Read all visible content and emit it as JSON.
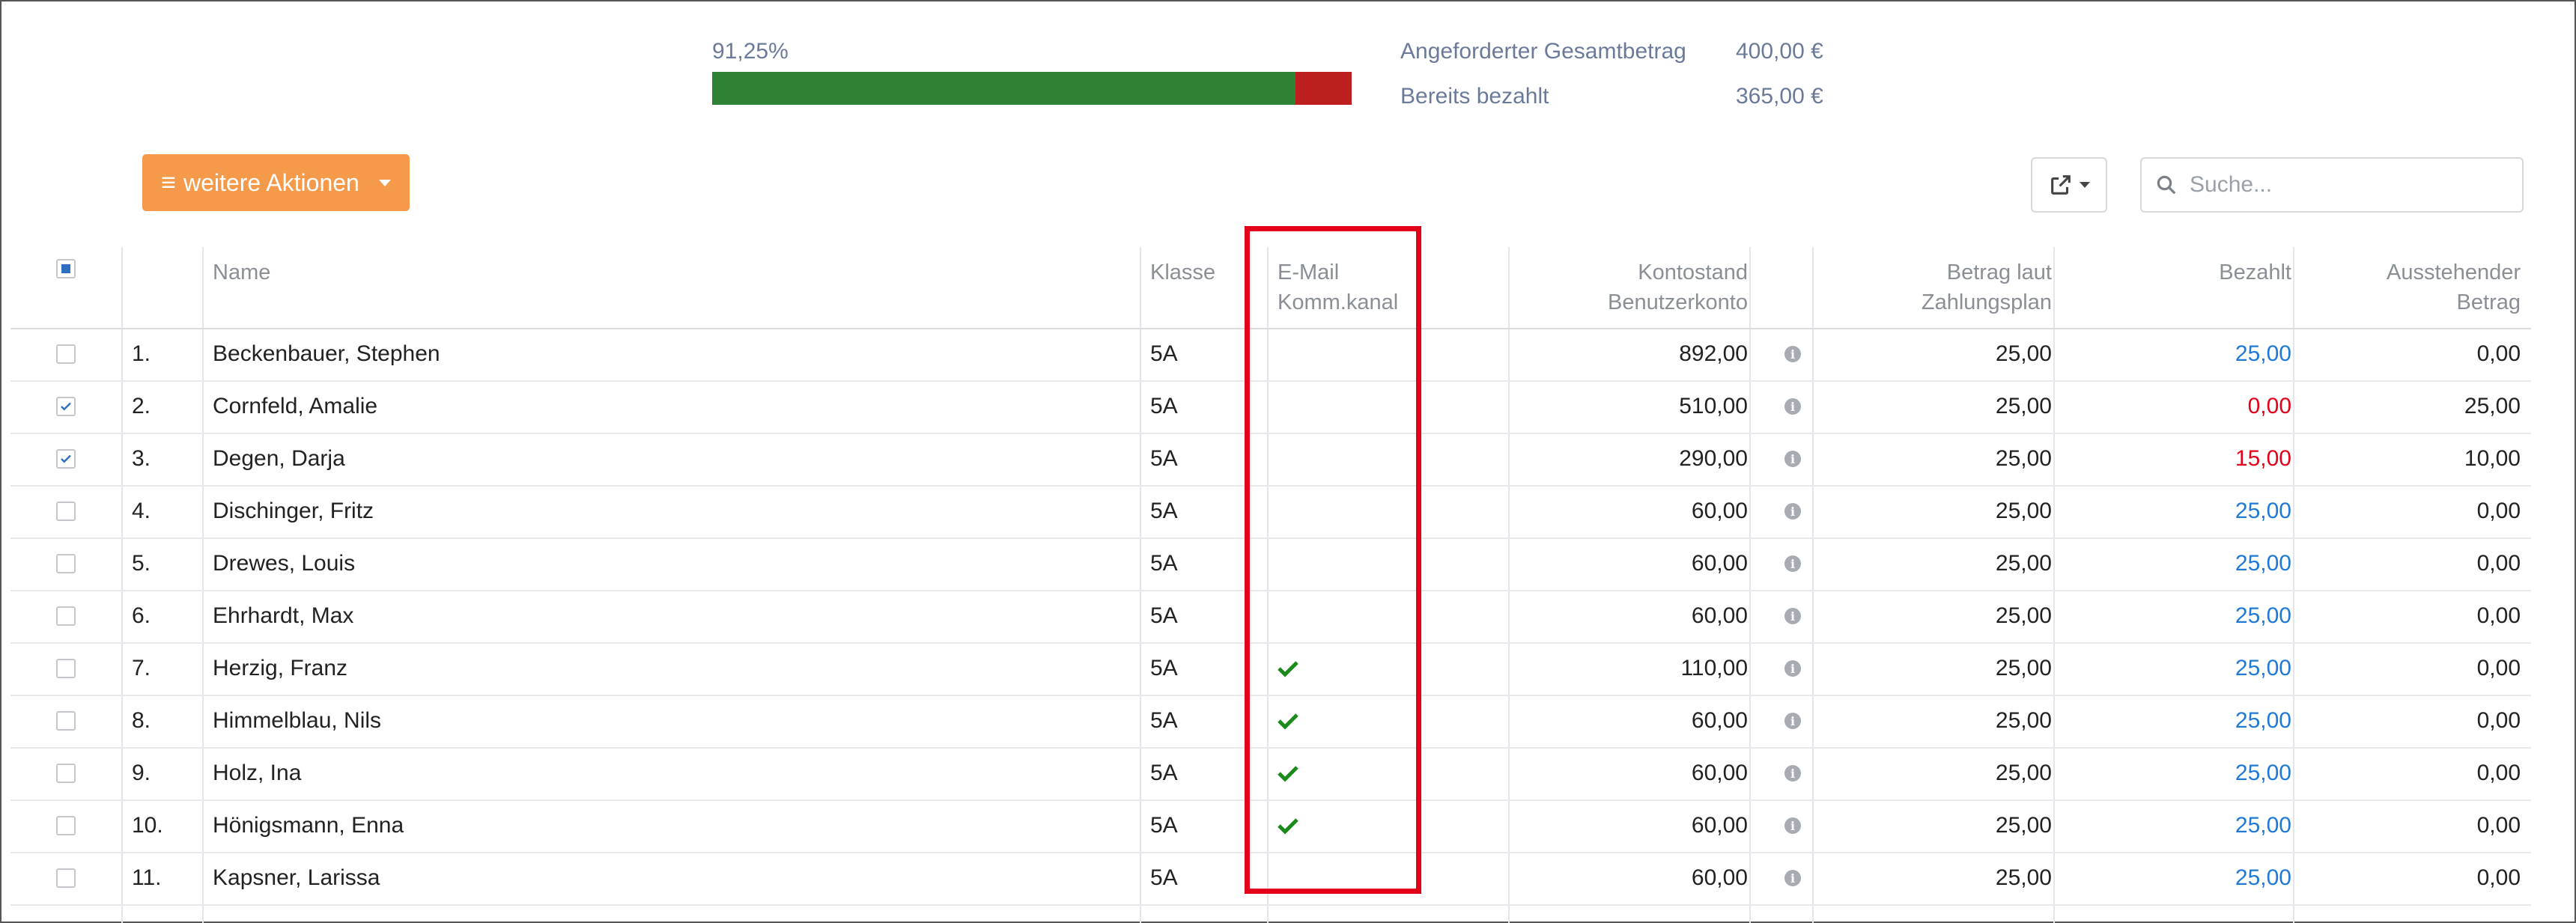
{
  "progress": {
    "label": "91,25%",
    "fraction": 0.9125
  },
  "summary": {
    "total_label": "Angeforderter Gesamtbetrag",
    "total_value": "400,00 €",
    "paid_label": "Bereits bezahlt",
    "paid_value": "365,00 €"
  },
  "toolbar": {
    "actions_label": "weitere Aktionen",
    "menu_icon": "≡",
    "search_placeholder": "Suche..."
  },
  "colors": {
    "progress_paid": "#2f8233",
    "progress_open": "#bd1e1e",
    "action_button": "#f59a4b",
    "paid_full": "#1e7ad6",
    "paid_short": "#e3001b",
    "check_green": "#1a8a1a",
    "highlight": "#e3001b"
  },
  "table": {
    "headers": {
      "name": "Name",
      "class": "Klasse",
      "email_line1": "E-Mail",
      "email_line2": "Komm.kanal",
      "konto_line1": "Kontostand",
      "konto_line2": "Benutzerkonto",
      "plan_line1": "Betrag laut",
      "plan_line2": "Zahlungsplan",
      "paid": "Bezahlt",
      "open_line1": "Ausstehender",
      "open_line2": "Betrag"
    },
    "rows": [
      {
        "checked": false,
        "num": "1.",
        "name": "Beckenbauer, Stephen",
        "class": "5A",
        "email": false,
        "konto": "892,00",
        "plan": "25,00",
        "paid": "25,00",
        "paid_status": "full",
        "open": "0,00"
      },
      {
        "checked": true,
        "num": "2.",
        "name": "Cornfeld, Amalie",
        "class": "5A",
        "email": false,
        "konto": "510,00",
        "plan": "25,00",
        "paid": "0,00",
        "paid_status": "short",
        "open": "25,00"
      },
      {
        "checked": true,
        "num": "3.",
        "name": "Degen, Darja",
        "class": "5A",
        "email": false,
        "konto": "290,00",
        "plan": "25,00",
        "paid": "15,00",
        "paid_status": "short",
        "open": "10,00"
      },
      {
        "checked": false,
        "num": "4.",
        "name": "Dischinger, Fritz",
        "class": "5A",
        "email": false,
        "konto": "60,00",
        "plan": "25,00",
        "paid": "25,00",
        "paid_status": "full",
        "open": "0,00"
      },
      {
        "checked": false,
        "num": "5.",
        "name": "Drewes, Louis",
        "class": "5A",
        "email": false,
        "konto": "60,00",
        "plan": "25,00",
        "paid": "25,00",
        "paid_status": "full",
        "open": "0,00"
      },
      {
        "checked": false,
        "num": "6.",
        "name": "Ehrhardt, Max",
        "class": "5A",
        "email": false,
        "konto": "60,00",
        "plan": "25,00",
        "paid": "25,00",
        "paid_status": "full",
        "open": "0,00"
      },
      {
        "checked": false,
        "num": "7.",
        "name": "Herzig, Franz",
        "class": "5A",
        "email": true,
        "konto": "110,00",
        "plan": "25,00",
        "paid": "25,00",
        "paid_status": "full",
        "open": "0,00"
      },
      {
        "checked": false,
        "num": "8.",
        "name": "Himmelblau, Nils",
        "class": "5A",
        "email": true,
        "konto": "60,00",
        "plan": "25,00",
        "paid": "25,00",
        "paid_status": "full",
        "open": "0,00"
      },
      {
        "checked": false,
        "num": "9.",
        "name": "Holz, Ina",
        "class": "5A",
        "email": true,
        "konto": "60,00",
        "plan": "25,00",
        "paid": "25,00",
        "paid_status": "full",
        "open": "0,00"
      },
      {
        "checked": false,
        "num": "10.",
        "name": "Hönigsmann, Enna",
        "class": "5A",
        "email": true,
        "konto": "60,00",
        "plan": "25,00",
        "paid": "25,00",
        "paid_status": "full",
        "open": "0,00"
      },
      {
        "checked": false,
        "num": "11.",
        "name": "Kapsner, Larissa",
        "class": "5A",
        "email": false,
        "konto": "60,00",
        "plan": "25,00",
        "paid": "25,00",
        "paid_status": "full",
        "open": "0,00"
      }
    ]
  }
}
